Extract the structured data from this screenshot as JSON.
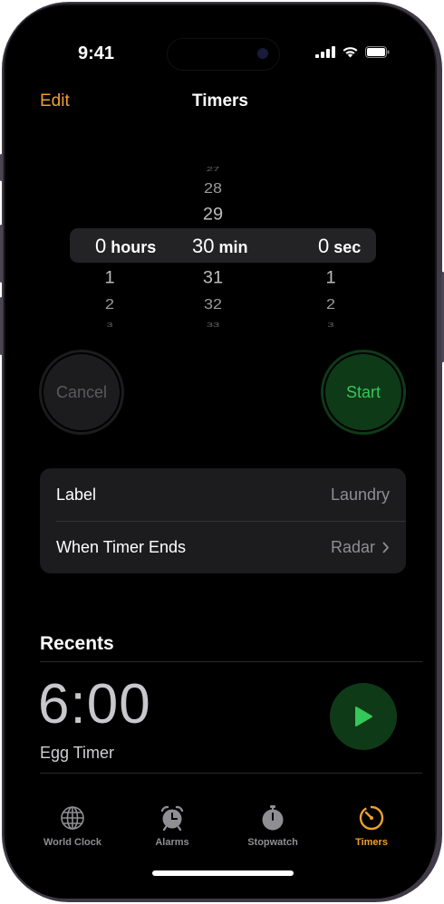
{
  "status": {
    "time": "9:41"
  },
  "nav": {
    "edit": "Edit",
    "title": "Timers"
  },
  "picker": {
    "hours": {
      "above": [],
      "selected": "0",
      "unit": "hours",
      "below": [
        "1",
        "2",
        "3"
      ]
    },
    "minutes": {
      "above": [
        "27",
        "28",
        "29"
      ],
      "selected": "30",
      "unit": "min",
      "below": [
        "31",
        "32",
        "33"
      ]
    },
    "seconds": {
      "above": [],
      "selected": "0",
      "unit": "sec",
      "below": [
        "1",
        "2",
        "3"
      ]
    }
  },
  "buttons": {
    "cancel": "Cancel",
    "start": "Start"
  },
  "settings": {
    "label_title": "Label",
    "label_value": "Laundry",
    "ends_title": "When Timer Ends",
    "ends_value": "Radar"
  },
  "recents": {
    "heading": "Recents",
    "items": [
      {
        "time": "6:00",
        "label": "Egg Timer"
      }
    ]
  },
  "tabs": [
    {
      "label": "World Clock",
      "icon": "globe-icon",
      "active": false
    },
    {
      "label": "Alarms",
      "icon": "alarm-clock-icon",
      "active": false
    },
    {
      "label": "Stopwatch",
      "icon": "stopwatch-icon",
      "active": false
    },
    {
      "label": "Timers",
      "icon": "timer-icon",
      "active": true
    }
  ],
  "colors": {
    "accent": "#f0a030",
    "start_green": "#35c759",
    "background": "#000000"
  }
}
